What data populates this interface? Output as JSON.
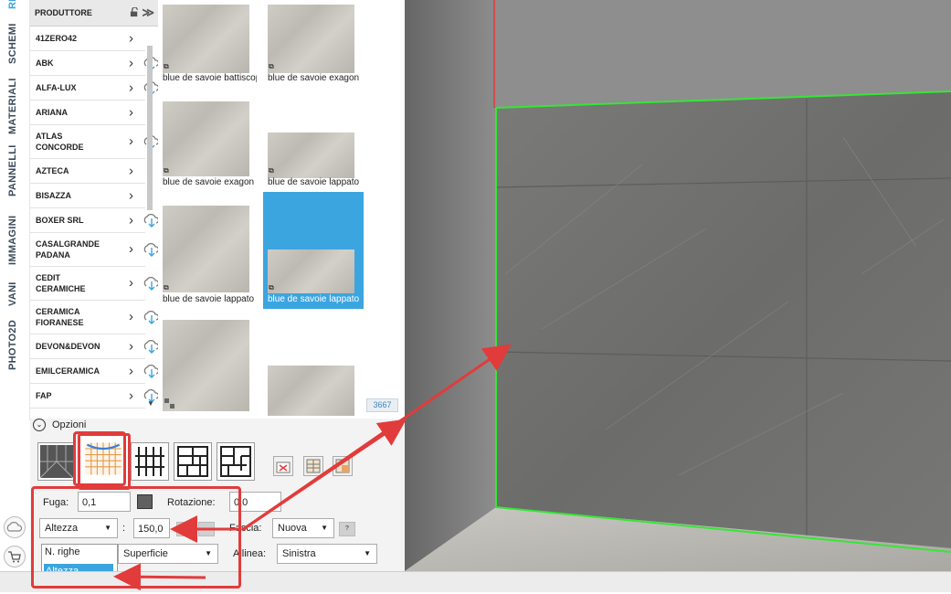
{
  "vertical_tabs": [
    "RIVESTIMENTI",
    "SCHEMI",
    "MATERIALI",
    "PANNELLI",
    "IMMAGINI",
    "VANI",
    "PHOTO2D"
  ],
  "producer_panel": {
    "header": "PRODUTTORE",
    "items": [
      {
        "label": "41ZERO42",
        "cloud": false
      },
      {
        "label": "ABK",
        "cloud": true
      },
      {
        "label": "ALFA-LUX",
        "cloud": true
      },
      {
        "label": "ARIANA",
        "cloud": false
      },
      {
        "label": "ATLAS CONCORDE",
        "cloud": true
      },
      {
        "label": "AZTECA",
        "cloud": false
      },
      {
        "label": "BISAZZA",
        "cloud": false
      },
      {
        "label": "BOXER SRL",
        "cloud": true
      },
      {
        "label": "CASALGRANDE PADANA",
        "cloud": true
      },
      {
        "label": "CEDIT CERAMICHE",
        "cloud": true
      },
      {
        "label": "CERAMICA FIORANESE",
        "cloud": true
      },
      {
        "label": "DEVON&DEVON",
        "cloud": true
      },
      {
        "label": "EMILCERAMICA",
        "cloud": true
      },
      {
        "label": "FAP",
        "cloud": true
      }
    ]
  },
  "thumbnails": {
    "items": [
      {
        "caption": "blue de savoie battiscopa",
        "selected": false
      },
      {
        "caption": "blue de savoie exagon",
        "selected": false
      },
      {
        "caption": "blue de savoie exagon",
        "selected": false
      },
      {
        "caption": "blue de savoie lappato",
        "selected": false
      },
      {
        "caption": "blue de savoie lappato",
        "selected": false
      },
      {
        "caption": "blue de savoie lappato",
        "selected": true
      },
      {
        "caption": "",
        "selected": false
      },
      {
        "caption": "",
        "selected": false
      }
    ],
    "count": "3667"
  },
  "options": {
    "toggle_label": "Opzioni",
    "fuga_label": "Fuga:",
    "fuga_value": "0,1",
    "rotazione_label": "Rotazione:",
    "rotazione_value": "0,0",
    "dimension_select": "Altezza",
    "dimension_value": "150,0",
    "colon": ":",
    "fascia_label": "Fascia:",
    "fascia_value": "Nuova",
    "help_label": "?",
    "superficie_value": "Superficie",
    "allinea_label": "Allinea:",
    "allinea_value": "Sinistra",
    "popup_options": [
      "N. righe",
      "Altezza"
    ],
    "popup_selected": "Altezza"
  },
  "colors": {
    "accent": "#3ba5e0",
    "annotation": "#e23b3b",
    "wall_edge": "#35e635"
  }
}
